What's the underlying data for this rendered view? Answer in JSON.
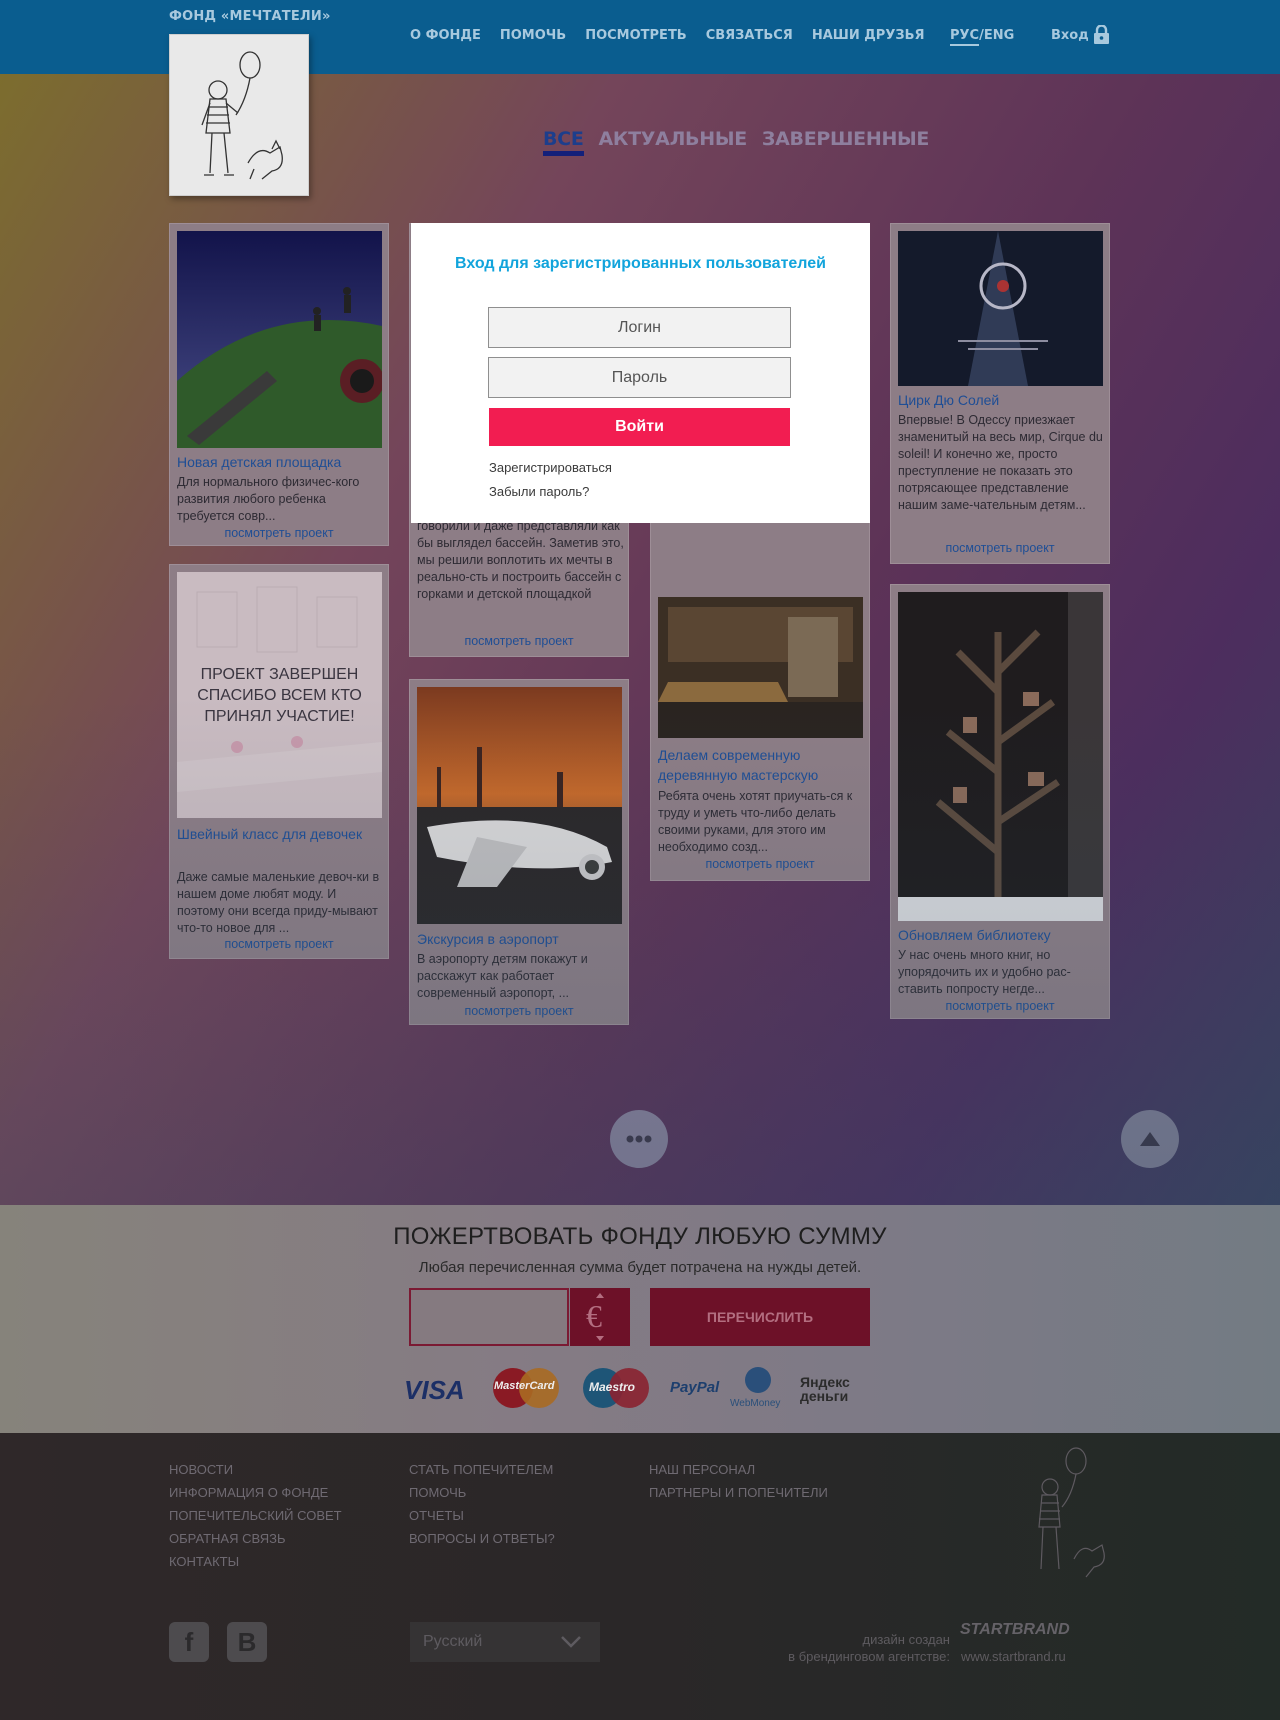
{
  "header": {
    "brand": "ФОНД «МЕЧТАТЕЛИ»",
    "nav": [
      "О ФОНДЕ",
      "ПОМОЧЬ",
      "ПОСМОТРЕТЬ",
      "СВЯЗАТЬСЯ",
      "НАШИ ДРУЗЬЯ"
    ],
    "lang_ru": "РУС",
    "lang_sep": "/",
    "lang_en": "ENG",
    "login": "Вход"
  },
  "filters": {
    "all": "ВСЕ",
    "current": "АКТУАЛЬНЫЕ",
    "finished": "ЗАВЕРШЕННЫЕ"
  },
  "cards": {
    "playground": {
      "title": "Новая детская площадка",
      "desc": "Для нормального физичес-кого развития любого ребенка требуется совр...",
      "more": "посмотреть проект"
    },
    "sewing": {
      "overlay": "ПРОЕКТ ЗАВЕРШЕН СПАСИБО ВСЕМ КТО ПРИНЯЛ УЧАСТИЕ!",
      "title": "Швейный класс для девочек",
      "desc": "Даже самые маленькие девоч-ки в нашем доме любят моду. И поэтому они всегда приду-мывают что-то новое для ...",
      "more": "посмотреть проект"
    },
    "pool": {
      "desc": "говорили и даже представляли как бы выглядел бассейн. Заметив это, мы решили воплотить их мечты в реально-сть и построить бассейн с горками и детской площадкой",
      "more": "посмотреть проект"
    },
    "airport": {
      "title": "Экскурсия в аэропорт",
      "desc": "В аэропорту детям покажут и расскажут как работает современный аэропорт, ...",
      "more": "посмотреть проект"
    },
    "workshop": {
      "title": "Делаем современную деревянную мастерскую",
      "desc": "Ребята очень хотят приучать-ся к труду и уметь что-либо делать своими руками, для этого им необходимо созд...",
      "more": "посмотреть проект"
    },
    "circus": {
      "title": "Цирк Дю Солей",
      "desc": "Впервые! В Одессу приезжает знаменитый на весь мир, Cirque du soleil! И конечно же, просто преступление не показать это потрясающее представление нашим заме-чательным детям...",
      "more": "посмотреть проект"
    },
    "library": {
      "title": "Обновляем библиотеку",
      "desc": "У нас очень много книг, но упорядочить их и удобно рас-ставить попросту негде...",
      "more": "посмотреть проект"
    }
  },
  "modal": {
    "title": "Вход для зарегистрированных пользователей",
    "login_placeholder": "Логин",
    "password_placeholder": "Пароль",
    "submit": "Войти",
    "register": "Зарегистрироваться",
    "forgot": "Забыли пароль?"
  },
  "donate": {
    "title": "ПОЖЕРТВОВАТЬ ФОНДУ ЛЮБУЮ СУММУ",
    "subtitle": "Любая перечисленная сумма будет потрачена на нужды детей.",
    "currency_symbol": "€",
    "button": "ПЕРЕЧИСЛИТЬ",
    "payments": [
      "VISA",
      "MasterCard",
      "Maestro",
      "PayPal",
      "WebMoney",
      "Яндекс деньги"
    ]
  },
  "footer": {
    "col1": [
      "НОВОСТИ",
      "ИНФОРМАЦИЯ О ФОНДЕ",
      "ПОПЕЧИТЕЛЬСКИЙ СОВЕТ",
      "ОБРАТНАЯ СВЯЗЬ",
      "КОНТАКТЫ"
    ],
    "col2": [
      "СТАТЬ ПОПЕЧИТЕЛЕМ",
      "ПОМОЧЬ",
      "ОТЧЕТЫ",
      "ВОПРОСЫ И ОТВЕТЫ?"
    ],
    "col3": [
      "НАШ ПЕРСОНАЛ",
      "ПАРТНЕРЫ И ПОПЕЧИТЕЛИ"
    ],
    "facebook": "f",
    "vk": "B",
    "language": "Русский",
    "credit_line1": "дизайн создан",
    "credit_line2": "в брендинговом агентстве:",
    "agency": "STARTBRAND",
    "agency_url": "www.startbrand.ru"
  },
  "colors": {
    "header_bg": "#0a5d8f",
    "accent_link": "#1f4e95",
    "modal_title": "#12a4dc",
    "login_button": "#f21d51"
  }
}
